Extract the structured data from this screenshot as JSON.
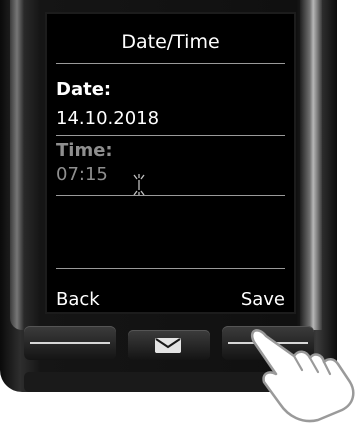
{
  "screen": {
    "title": "Date/Time",
    "date_label": "Date:",
    "date_value": "14.10.2018",
    "time_label": "Time:",
    "time_value": "07:15",
    "softkey_left": "Back",
    "softkey_right": "Save"
  },
  "keys": {
    "left_key_icon": "softkey-bar-icon",
    "middle_key_icon": "envelope-icon",
    "right_key_icon": "softkey-bar-icon"
  },
  "pointer": {
    "icon": "pointing-hand-icon"
  },
  "colors": {
    "screen_bg": "#000000",
    "screen_text": "#ffffff",
    "dim_text": "#8f8f8f",
    "device_body": "#151515"
  }
}
